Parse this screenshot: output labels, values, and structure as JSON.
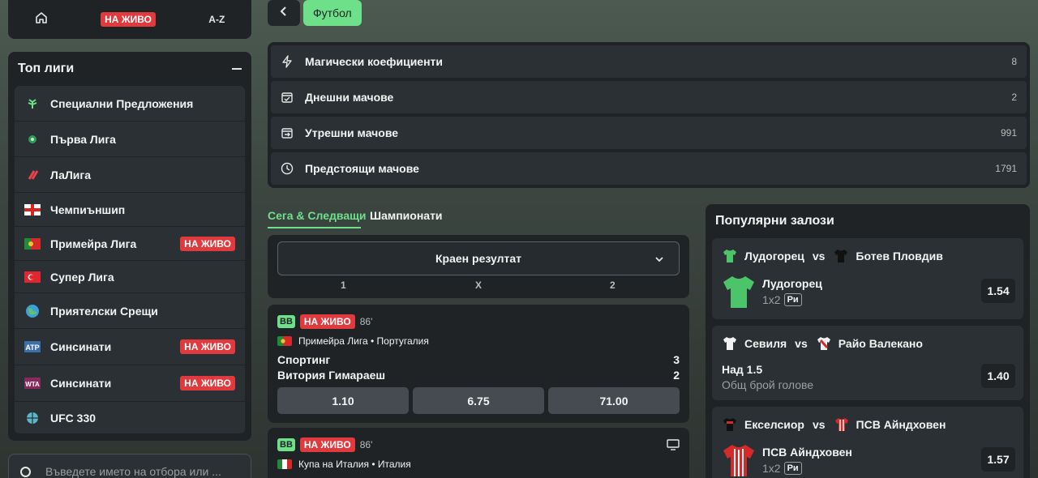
{
  "topnav": {
    "live_label": "НА ЖИВО",
    "az_label": "A-Z"
  },
  "leagues": {
    "title": "Топ лиги",
    "items": [
      {
        "label": "Специални Предложения",
        "icon": "special-offers-icon",
        "live": ""
      },
      {
        "label": "Първа Лига",
        "icon": "first-league-icon",
        "live": ""
      },
      {
        "label": "ЛаЛига",
        "icon": "laliga-icon",
        "live": ""
      },
      {
        "label": "Чемпиъншип",
        "icon": "england-flag-icon",
        "live": ""
      },
      {
        "label": "Примейра Лига",
        "icon": "portugal-flag-icon",
        "live": "НА ЖИВО"
      },
      {
        "label": "Супер Лига",
        "icon": "turkey-flag-icon",
        "live": ""
      },
      {
        "label": "Приятелски Срещи",
        "icon": "globe-icon",
        "live": ""
      },
      {
        "label": "Синсинати",
        "icon": "atp-icon",
        "live": "НА ЖИВО"
      },
      {
        "label": "Синсинати",
        "icon": "wta-icon",
        "live": "НА ЖИВО"
      },
      {
        "label": "UFC 330",
        "icon": "ufc-globe-icon",
        "live": ""
      }
    ]
  },
  "search": {
    "placeholder": "Въведете името на отбора или ..."
  },
  "header": {
    "sport": "Футбол"
  },
  "categories": [
    {
      "label": "Магически коефициенти",
      "count": "8",
      "icon": "lightning-icon"
    },
    {
      "label": "Днешни мачове",
      "count": "2",
      "icon": "calendar-check-icon"
    },
    {
      "label": "Утрешни мачове",
      "count": "991",
      "icon": "calendar-arrow-icon"
    },
    {
      "label": "Предстоящи мачове",
      "count": "1791",
      "icon": "clock-icon"
    }
  ],
  "tabs": {
    "now_next": "Сега & Следващи",
    "championships": "Шампионати"
  },
  "market": {
    "selected": "Краен резултат",
    "col1": "1",
    "colx": "X",
    "col2": "2"
  },
  "matches": [
    {
      "bb": "BB",
      "live": "НА ЖИВО",
      "minute": "86'",
      "league": "Примейра Лига • Португалия",
      "home": "Спортинг",
      "home_score": "3",
      "away": "Витория Гимараеш",
      "away_score": "2",
      "odds": [
        "1.10",
        "6.75",
        "71.00"
      ]
    },
    {
      "bb": "BB",
      "live": "НА ЖИВО",
      "minute": "86'",
      "league": "Купа на Италия • Италия"
    }
  ],
  "popular": {
    "title": "Популярни залози",
    "vs": "vs",
    "cards": [
      {
        "home": "Лудогорец",
        "away": "Ботев Пловдив",
        "pick": "Лудогорец",
        "sub": "1x2",
        "tag": "Ри",
        "odd": "1.54"
      },
      {
        "home": "Севиля",
        "away": "Райо Валекано",
        "pick": "Над 1.5",
        "sub": "Общ брой голове",
        "tag": "",
        "odd": "1.40"
      },
      {
        "home": "Екселсиор",
        "away": "ПСВ Айндховен",
        "pick": "ПСВ Айндховен",
        "sub": "1x2",
        "tag": "Ри",
        "odd": "1.57"
      }
    ]
  },
  "colors": {
    "accent": "#6fe08a",
    "live": "#e03a3e",
    "panel": "#1f2326",
    "row": "#2b3034"
  }
}
